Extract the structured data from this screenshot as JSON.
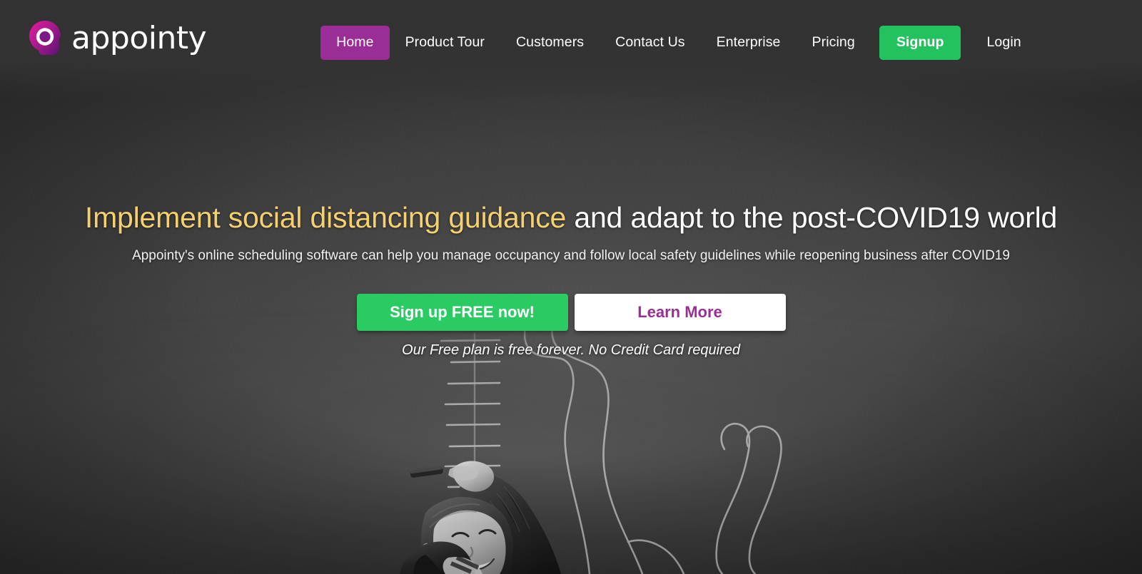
{
  "brand": {
    "name": "appointy",
    "logo_icon": "appointy-pin-logo-icon",
    "accent_purple": "#9B2D96",
    "accent_green": "#22C35E",
    "accent_yellow": "#F4D06F"
  },
  "nav": {
    "items": [
      {
        "label": "Home",
        "style": "active"
      },
      {
        "label": "Product Tour",
        "style": "plain"
      },
      {
        "label": "Customers",
        "style": "plain"
      },
      {
        "label": "Contact Us",
        "style": "plain"
      },
      {
        "label": "Enterprise",
        "style": "plain"
      },
      {
        "label": "Pricing",
        "style": "plain"
      },
      {
        "label": "Signup",
        "style": "signup"
      },
      {
        "label": "Login",
        "style": "login"
      }
    ]
  },
  "hero": {
    "title_highlight": "Implement social distancing guidance",
    "title_rest": " and adapt to the post-COVID19 world",
    "subtitle": "Appointy's online scheduling software can help you manage occupancy and follow local safety guidelines while reopening business after COVID19",
    "primary_cta": "Sign up FREE now!",
    "secondary_cta": "Learn More",
    "note": "Our Free plan is free forever. No Credit Card required",
    "background_image": "child-reaching-chalkboard-height-chart-photo"
  }
}
